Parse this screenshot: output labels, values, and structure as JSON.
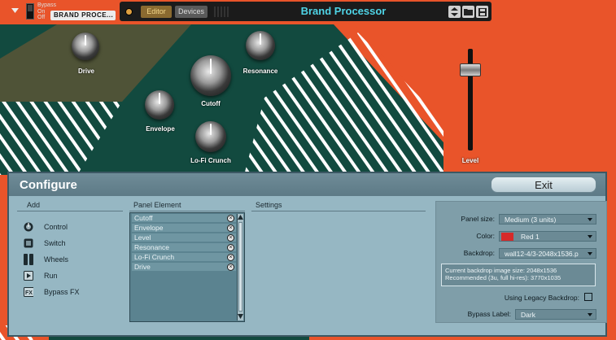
{
  "header": {
    "bypass_label": "Bypass",
    "on_label": "On",
    "off_label": "Off",
    "device_name": "BRAND PROCE...",
    "tab_editor": "Editor",
    "tab_devices": "Devices",
    "title": "Brand Processor",
    "accent_color": "#4fd4e6"
  },
  "knobs": {
    "drive": "Drive",
    "resonance": "Resonance",
    "cutoff": "Cutoff",
    "envelope": "Envelope",
    "lofi": "Lo-Fi Crunch"
  },
  "fader": {
    "label": "Level"
  },
  "configure": {
    "title": "Configure",
    "exit_label": "Exit",
    "add_title": "Add",
    "panel_element_title": "Panel Element",
    "settings_title": "Settings",
    "add_items": [
      {
        "label": "Control",
        "icon": "knob-icon"
      },
      {
        "label": "Switch",
        "icon": "switch-icon"
      },
      {
        "label": "Wheels",
        "icon": "wheels-icon"
      },
      {
        "label": "Run",
        "icon": "play-icon"
      },
      {
        "label": "Bypass FX",
        "icon": "fx-icon"
      }
    ],
    "panel_elements": [
      "Cutoff",
      "Envelope",
      "Level",
      "Resonance",
      "Lo-Fi Crunch",
      "Drive"
    ],
    "settings": {
      "panel_size_label": "Panel size:",
      "panel_size_value": "Medium (3 units)",
      "color_label": "Color:",
      "color_value": "Red 1",
      "color_swatch": "#d62a2a",
      "backdrop_label": "Backdrop:",
      "backdrop_value": "wall12-4/3-2048x1536.p",
      "info_line1": "Current backdrop image size: 2048x1536",
      "info_line2": "Recommended (3u, full hi-res): 3770x1035",
      "legacy_label": "Using Legacy Backdrop:",
      "bypass_label_label": "Bypass Label:",
      "bypass_label_value": "Dark"
    }
  }
}
